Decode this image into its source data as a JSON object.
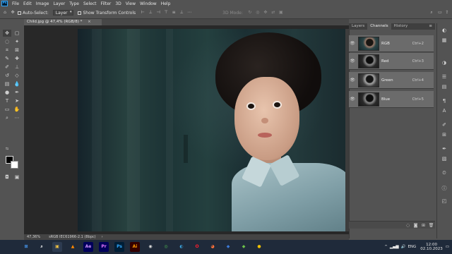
{
  "menubar": {
    "logo": "Ps",
    "items": [
      "File",
      "Edit",
      "Image",
      "Layer",
      "Type",
      "Select",
      "Filter",
      "3D",
      "View",
      "Window",
      "Help"
    ]
  },
  "options": {
    "auto_select_label": "Auto-Select:",
    "auto_select_value": "Layer",
    "transform_label": "Show Transform Controls",
    "mode_label": "3D Mode:"
  },
  "document": {
    "tab_title": "Child.jpg @ 47,4% (RGB/8) *",
    "zoom": "47,36%",
    "color_profile": "sRGB IEC61966-2.1 (8bpc)"
  },
  "panel": {
    "tabs": [
      "Layers",
      "Channels",
      "History"
    ],
    "active_tab": "Channels",
    "channels": [
      {
        "name": "RGB",
        "shortcut": "Ctrl+2",
        "thumb": "rgb"
      },
      {
        "name": "Red",
        "shortcut": "Ctrl+3",
        "thumb": "gray"
      },
      {
        "name": "Green",
        "shortcut": "Ctrl+4",
        "thumb": "gray2"
      },
      {
        "name": "Blue",
        "shortcut": "Ctrl+5",
        "thumb": "gray"
      }
    ]
  },
  "taskbar": {
    "apps": [
      {
        "name": "start",
        "label": "⊞",
        "color": "#4aa0ff",
        "bg": "#1f2a3a"
      },
      {
        "name": "search",
        "label": "⌕",
        "color": "#ffffff",
        "bg": "#1f2a3a"
      },
      {
        "name": "files",
        "label": "▣",
        "color": "#f4c542",
        "bg": "#2d3b50"
      },
      {
        "name": "vlc",
        "label": "▲",
        "color": "#ff8800",
        "bg": "#1f2a3a"
      },
      {
        "name": "ae",
        "label": "Ae",
        "color": "#d291ff",
        "bg": "#00005b"
      },
      {
        "name": "pr",
        "label": "Pr",
        "color": "#ea77ff",
        "bg": "#00005b"
      },
      {
        "name": "ps",
        "label": "Ps",
        "color": "#31a8ff",
        "bg": "#001e36"
      },
      {
        "name": "ai",
        "label": "Ai",
        "color": "#ff9a00",
        "bg": "#330000"
      },
      {
        "name": "obs",
        "label": "◉",
        "color": "#dddddd",
        "bg": "#1f2a3a"
      },
      {
        "name": "chrome",
        "label": "◎",
        "color": "#4caf50",
        "bg": "#1f2a3a"
      },
      {
        "name": "edge",
        "label": "◐",
        "color": "#3aa0d8",
        "bg": "#1f2a3a"
      },
      {
        "name": "opera",
        "label": "O",
        "color": "#ff1b2d",
        "bg": "#1f2a3a"
      },
      {
        "name": "firefox",
        "label": "◕",
        "color": "#ff7139",
        "bg": "#1f2a3a"
      },
      {
        "name": "app-blue",
        "label": "◆",
        "color": "#3d7bd8",
        "bg": "#1f2a3a"
      },
      {
        "name": "app-green",
        "label": "◆",
        "color": "#6cc24a",
        "bg": "#1f2a3a"
      },
      {
        "name": "app-yellow",
        "label": "●",
        "color": "#f2c200",
        "bg": "#1f2a3a"
      }
    ],
    "language": "ENG",
    "time": "12:00",
    "date": "02.10.2023"
  }
}
